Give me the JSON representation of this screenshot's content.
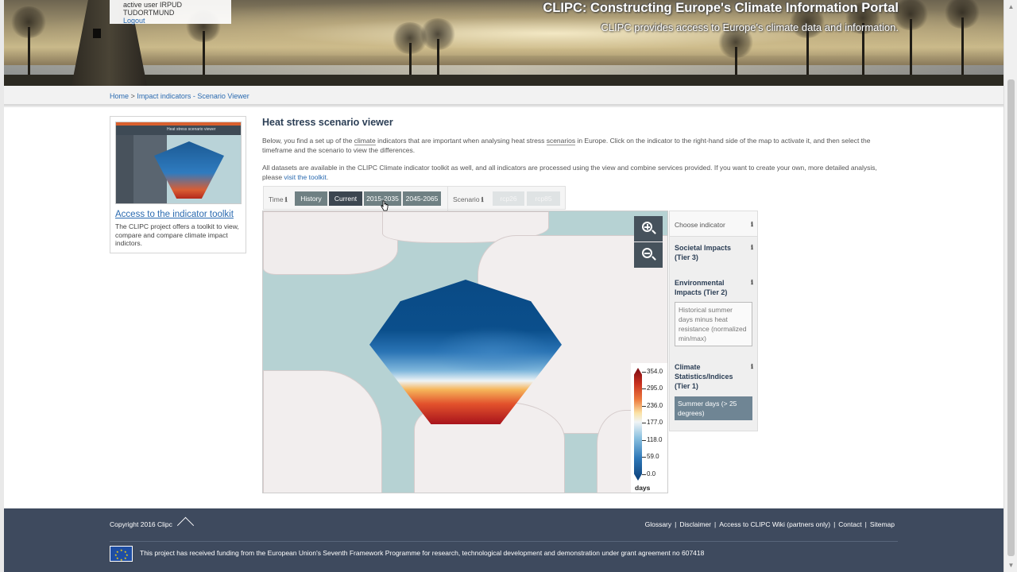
{
  "header": {
    "user_status": "active user IRPUD",
    "user_org": "TUDORTMUND",
    "logout_label": "Logout",
    "portal_title": "CLIPC: Constructing Europe's Climate Information Portal",
    "portal_subtitle": "CLIPC provides access to Europe's climate data and information."
  },
  "breadcrumb": {
    "home": "Home",
    "separator": ">",
    "current": "Impact indicators - Scenario Viewer"
  },
  "toolkit_card": {
    "thumb_caption": "Heat stress scenario viewer",
    "title": "Access to the indicator toolkit",
    "description": "The CLIPC project offers a toolkit to view, compare and compare climate impact indictors."
  },
  "main": {
    "title": "Heat stress scenario viewer",
    "intro_part1": "Below, you find a set up of the ",
    "intro_word_climate": "climate",
    "intro_part2": " indicators that are important when analysing heat stress ",
    "intro_word_scenarios": "scenarios",
    "intro_part3": " in Europe. Click on the indicator to the right-hand side of the map to activate it, and then select the timeframe and the scenario to view the differences.",
    "intro2_text": "All datasets are available in the CLIPC Climate indicator toolkit as well, and all indicators are processed using the view and combine services provided. If you want to create your own, more detailed analysis, please ",
    "intro2_link": "visit the toolkit",
    "intro2_end": "."
  },
  "controls": {
    "time_label": "Time",
    "time_buttons": [
      "History",
      "Current",
      "2015-2035",
      "2045-2065"
    ],
    "time_active": "Current",
    "scenario_label": "Scenario",
    "scenario_buttons": [
      "rcp26",
      "rcp85"
    ],
    "info_icon": "ℹ"
  },
  "map": {
    "zoom_in": "zoom-in",
    "zoom_out": "zoom-out",
    "legend_values": [
      "354.0",
      "295.0",
      "236.0",
      "177.0",
      "118.0",
      "59.0",
      "0.0"
    ],
    "legend_unit": "days"
  },
  "indicators": {
    "header": "Choose indicator",
    "categories": [
      {
        "label": "Societal Impacts (Tier 3)"
      },
      {
        "label": "Environmental Impacts (Tier 2)"
      },
      {
        "label": "Climate Statistics/Indices (Tier 1)"
      }
    ],
    "items": [
      {
        "label": "Historical summer days minus heat resistance (normalized min/max)",
        "selected": false
      },
      {
        "label": "Summer days (> 25 degrees)",
        "selected": true
      }
    ]
  },
  "footer": {
    "copyright": "Copyright 2016 Clipc",
    "links": [
      "Glossary",
      "Disclaimer",
      "Access to CLIPC Wiki (partners only)",
      "Contact",
      "Sitemap"
    ],
    "funding": "This project has received funding from the European Union's Seventh Framework Programme for research, technological development and demonstration under grant agreement no 607418"
  },
  "colors": {
    "accent": "#2a6ab0",
    "footer_bg": "#3e4a5e",
    "button_active": "#3c4650",
    "button": "#6f8083",
    "selected_indicator": "#6f8594"
  }
}
